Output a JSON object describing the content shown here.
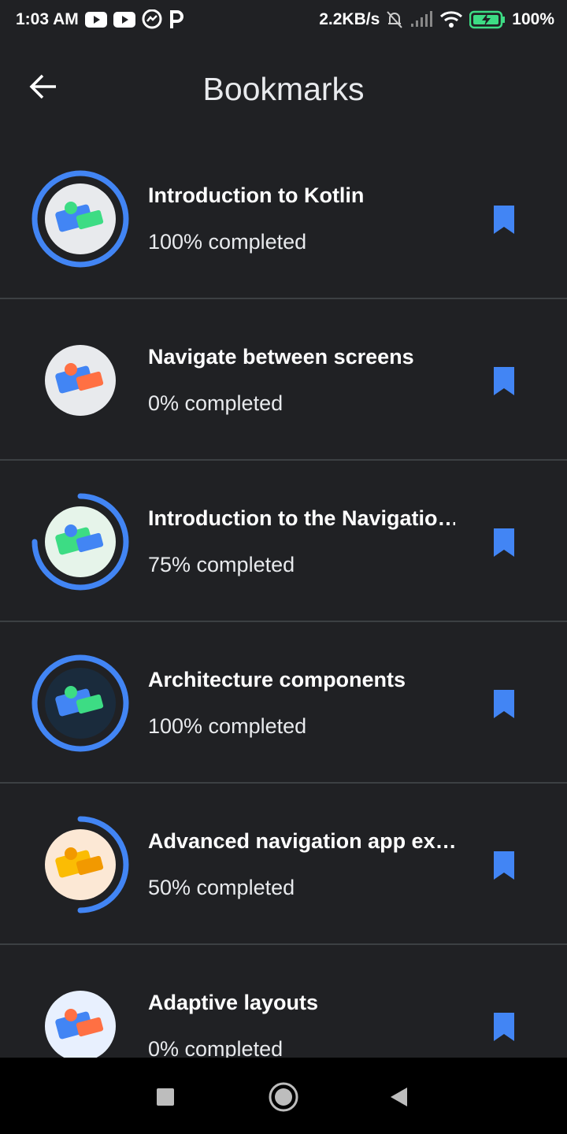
{
  "status_bar": {
    "time": "1:03 AM",
    "net_speed": "2.2KB/s",
    "battery": "100%",
    "icons_left": [
      "youtube-icon",
      "youtube-icon",
      "messenger-icon",
      "p-icon"
    ],
    "icons_right": [
      "bell-off-icon",
      "signal-icon",
      "wifi-icon",
      "battery-charging-icon"
    ]
  },
  "app_bar": {
    "title": "Bookmarks",
    "back_icon": "arrow-back-icon"
  },
  "accent_color": "#4285f4",
  "bookmarks": [
    {
      "title": "Introduction to Kotlin",
      "progress_text": "100% completed",
      "progress": 1.0
    },
    {
      "title": "Navigate between screens",
      "progress_text": "0% completed",
      "progress": 0.0
    },
    {
      "title": "Introduction to the Navigatio…",
      "progress_text": "75% completed",
      "progress": 0.75
    },
    {
      "title": "Architecture components",
      "progress_text": "100% completed",
      "progress": 1.0
    },
    {
      "title": "Advanced navigation app ex…",
      "progress_text": "50% completed",
      "progress": 0.5
    },
    {
      "title": "Adaptive layouts",
      "progress_text": "0% completed",
      "progress": 0.0
    }
  ],
  "nav_bar": {
    "icons": [
      "recents-square-icon",
      "home-circle-icon",
      "back-triangle-icon"
    ]
  }
}
